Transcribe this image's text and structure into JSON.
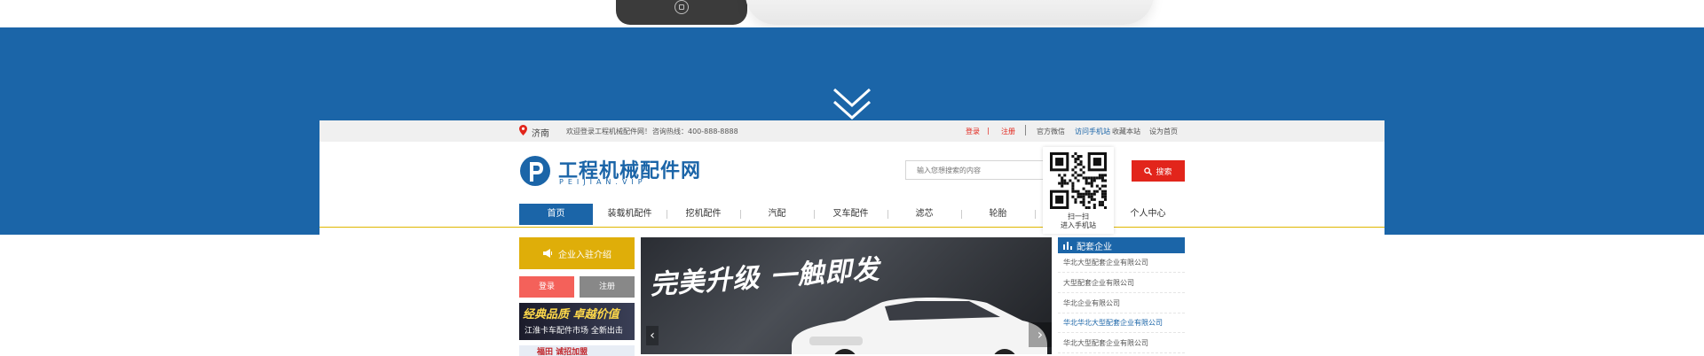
{
  "topbar": {
    "city": "济南",
    "welcome": "欢迎登录工程机械配件网！",
    "hotline": "咨询热线：400-888-8888",
    "login": "登录",
    "separator": "|",
    "register": "注册",
    "weibo": "官方微信",
    "mobile": "访问手机站",
    "favorite": "收藏本站",
    "set_home": "设为首页"
  },
  "logo": {
    "cn": "工程机械配件网",
    "en": "PEIJIAN.VIP"
  },
  "search": {
    "placeholder": "输入您想搜索的内容",
    "button": "搜索"
  },
  "qr_popup": {
    "line1": "扫一扫",
    "line2": "进入手机站"
  },
  "nav": {
    "items": [
      "首页",
      "装载机配件",
      "挖机配件",
      "汽配",
      "叉车配件",
      "滤芯",
      "轮胎",
      "",
      "个人中心"
    ]
  },
  "left": {
    "join": "企业入驻介绍",
    "login": "登录",
    "register": "注册",
    "ad1_title": "经典品质 卓越价值",
    "ad1_sub": "江淮卡车配件市场 全新出击",
    "ad2_title": "福田 诚招加盟"
  },
  "banner": {
    "slogan": "完美升级 一触即发",
    "prev": "‹",
    "next": "›"
  },
  "side": {
    "header": "配套企业",
    "items": [
      "华北大型配套企业有限公司",
      "大型配套企业有限公司",
      "华北企业有限公司",
      "华北华北大型配套企业有限公司",
      "华北大型配套企业有限公司"
    ],
    "highlight_index": 3
  },
  "colors": {
    "primary_blue": "#1b65a8",
    "accent_red": "#e2251b",
    "accent_yellow": "#dfae09"
  },
  "icons": [
    "pin-icon",
    "chevron-down-icon",
    "search-icon",
    "qr-code-icon",
    "megaphone-icon",
    "bar-chart-icon",
    "arrow-left-icon",
    "arrow-right-icon"
  ]
}
